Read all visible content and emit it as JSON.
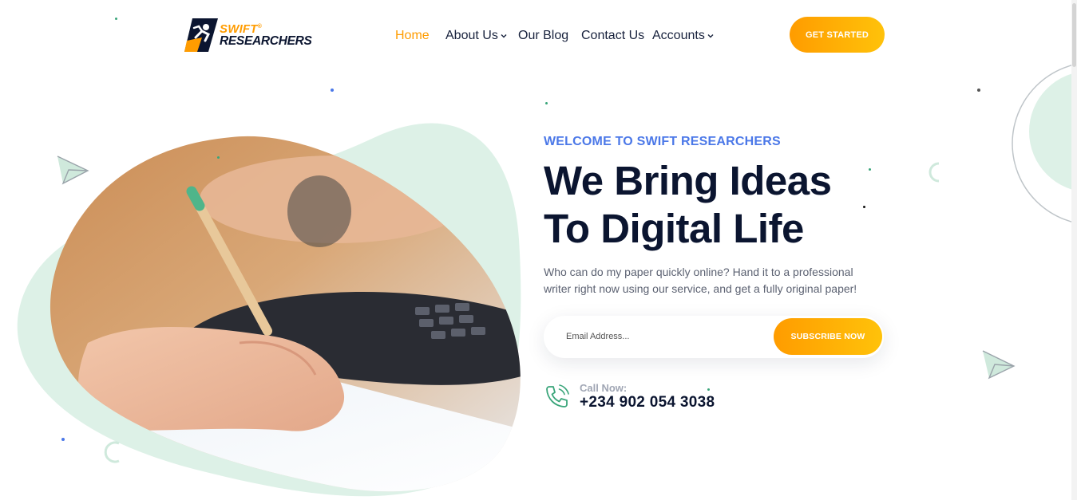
{
  "brand": {
    "line1": "SWIFT",
    "line2": "RESEARCHERS",
    "accent": "#ff9c00",
    "dark": "#0b1530"
  },
  "nav": {
    "items": [
      {
        "label": "Home",
        "active": true,
        "dropdown": false
      },
      {
        "label": "About Us",
        "active": false,
        "dropdown": true
      },
      {
        "label": "Our Blog",
        "active": false,
        "dropdown": false
      },
      {
        "label": "Contact Us",
        "active": false,
        "dropdown": false
      },
      {
        "label": "Accounts",
        "active": false,
        "dropdown": true
      }
    ],
    "cta": "GET STARTED"
  },
  "hero": {
    "eyebrow": "WELCOME TO SWIFT RESEARCHERS",
    "headline_line1": "We Bring Ideas",
    "headline_line2": "To Digital Life",
    "description": "Who can do my paper quickly online? Hand it to a professional writer right now using our service, and get a fully original paper!",
    "email_placeholder": "Email Address...",
    "subscribe_label": "SUBSCRIBE NOW",
    "call_label": "Call Now:",
    "call_number": "+234 902 054 3038",
    "image_subject": "hand writing with pencil on paper beside a calculator"
  },
  "colors": {
    "accent_orange": "#ff9c00",
    "accent_yellow": "#ffc20a",
    "eyebrow_blue": "#4b78e8",
    "mint_blob": "#ddf1e7",
    "phone_icon_green": "#3aa57a"
  },
  "icons": [
    "logo-runner-icon",
    "chevron-down-icon",
    "paper-plane-icon",
    "phone-icon"
  ]
}
